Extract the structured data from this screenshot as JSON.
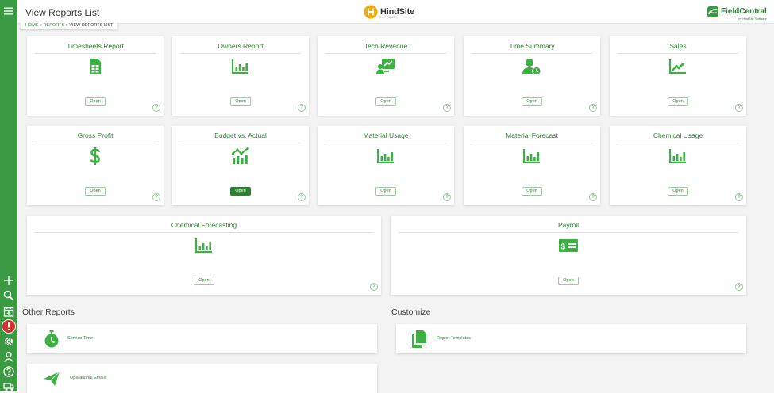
{
  "header": {
    "title": "View Reports List",
    "brand": "HindSite",
    "brand_sub": "SOFTWARE",
    "partner": "FieldCentral",
    "partner_sub": "by HindSite Software"
  },
  "breadcrumb": {
    "home": "HOME",
    "reports": "REPORTS",
    "current": "VIEW REPORTS LIST",
    "sep": "»"
  },
  "cards": [
    {
      "title": "Timesheets Report",
      "icon": "spreadsheet-icon",
      "open": "Open",
      "help": "?"
    },
    {
      "title": "Owners Report",
      "icon": "bar-chart-icon",
      "open": "Open",
      "help": "?"
    },
    {
      "title": "Tech Revenue",
      "icon": "presentation-chart-icon",
      "open": "Open",
      "help": "?"
    },
    {
      "title": "Time Summary",
      "icon": "user-clock-icon",
      "open": "Open",
      "help": "?"
    },
    {
      "title": "Sales",
      "icon": "trend-chart-icon",
      "open": "Open",
      "help": "?"
    },
    {
      "title": "Gross Profit",
      "icon": "dollar-icon",
      "open": "Open",
      "help": "?"
    },
    {
      "title": "Budget vs. Actual",
      "icon": "bar-line-chart-icon",
      "open": "Open",
      "help": "?"
    },
    {
      "title": "Material Usage",
      "icon": "bar-chart-icon",
      "open": "Open",
      "help": "?"
    },
    {
      "title": "Material Forecast",
      "icon": "bar-chart-icon",
      "open": "Open",
      "help": "?"
    },
    {
      "title": "Chemical Usage",
      "icon": "bar-chart-icon",
      "open": "Open",
      "help": "?"
    },
    {
      "title": "Chemical Forecasting",
      "icon": "bar-chart-icon",
      "open": "Open",
      "help": "?"
    },
    {
      "title": "Payroll",
      "icon": "money-check-icon",
      "open": "Open",
      "help": "?"
    }
  ],
  "other_reports": {
    "heading": "Other Reports",
    "items": [
      {
        "label": "Service Time",
        "icon": "stopwatch-icon"
      },
      {
        "label": "Operational Emails",
        "icon": "paper-plane-icon"
      }
    ]
  },
  "customize": {
    "heading": "Customize",
    "items": [
      {
        "label": "Report Templates",
        "icon": "copy-icon"
      }
    ]
  },
  "sidebar": {
    "icons": [
      "menu-icon",
      "add-icon",
      "search-icon",
      "calendar-icon",
      "alert-icon",
      "gear-icon",
      "user-icon",
      "help-icon",
      "truck-icon"
    ]
  },
  "colors": {
    "sidebar": "#3a9a42",
    "accent": "#3cb043",
    "text_green": "#2e7d32",
    "alert": "#d32f2f"
  }
}
